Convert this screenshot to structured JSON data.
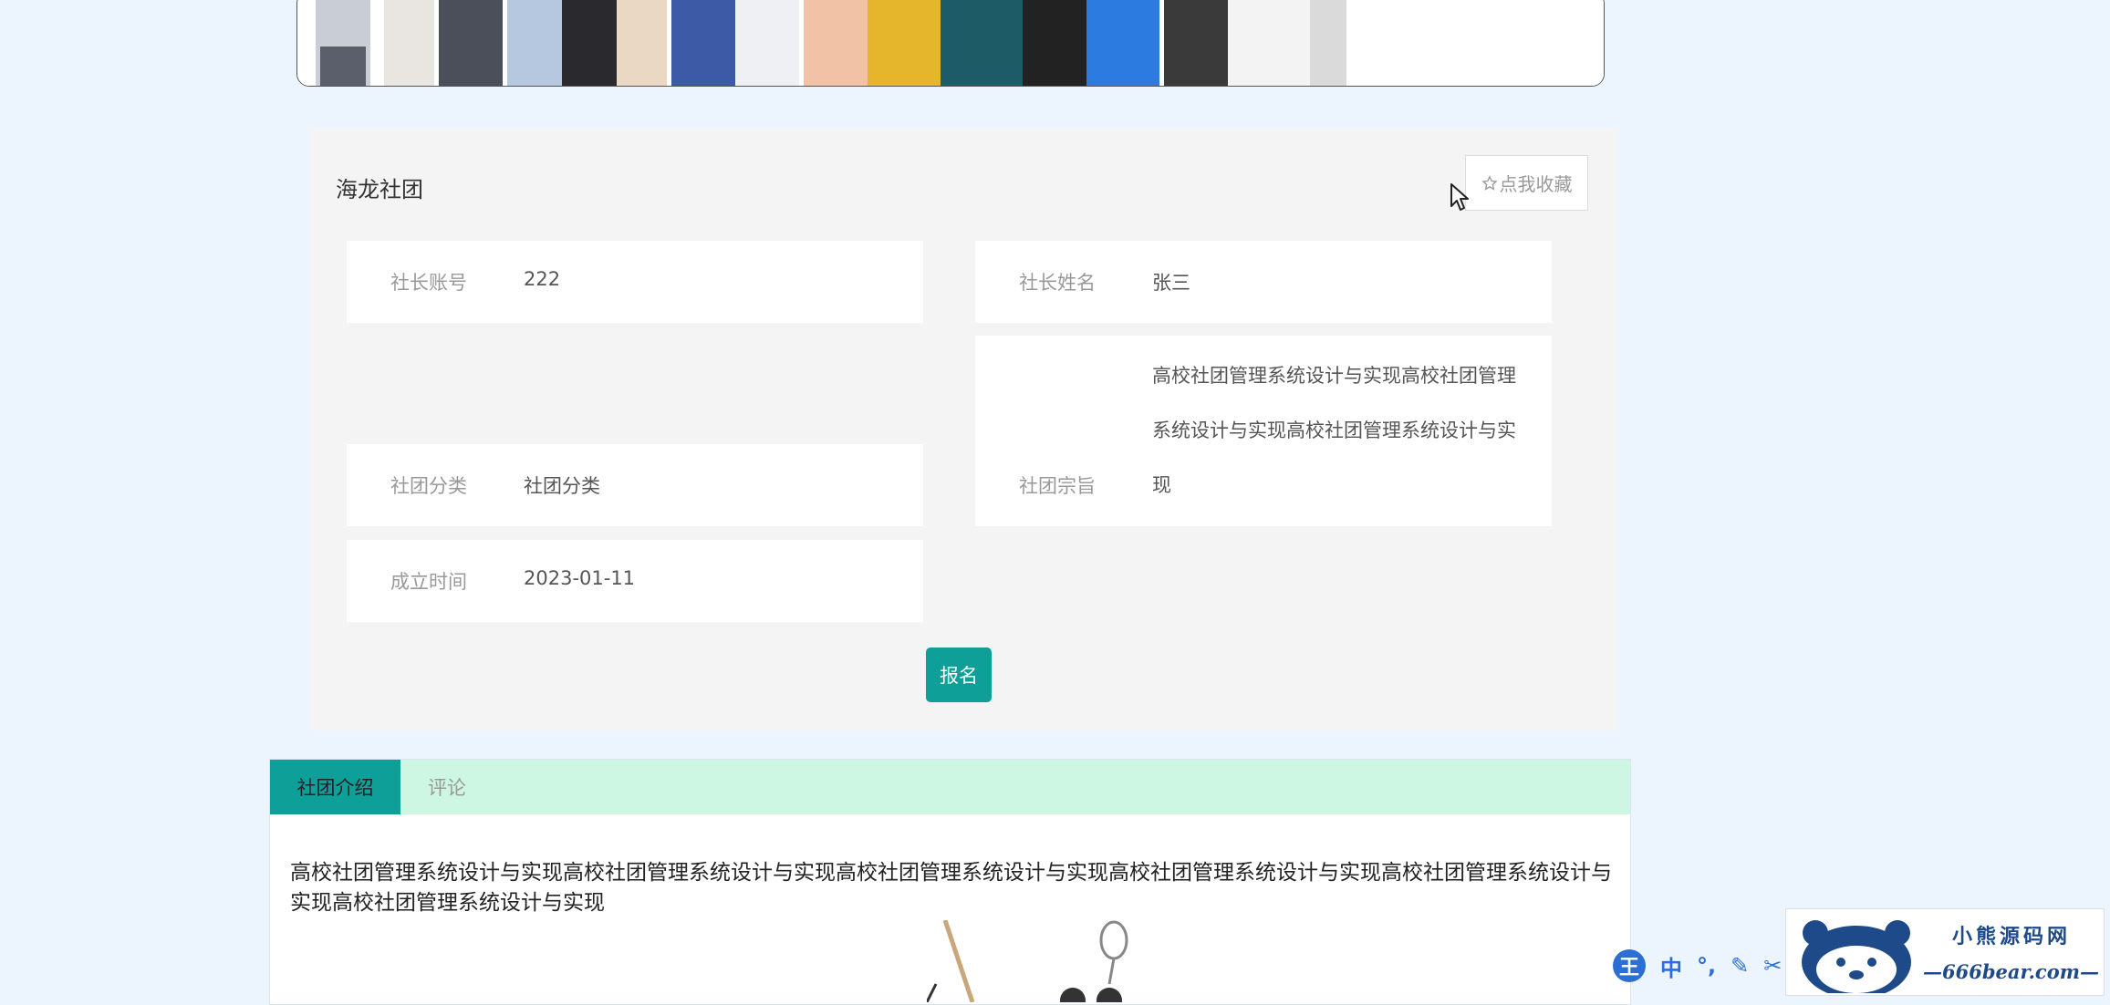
{
  "club": {
    "name": "海龙社团",
    "favorite_label": "点我收藏",
    "fields": [
      {
        "label": "社长账号",
        "value": "222"
      },
      {
        "label": "社长姓名",
        "value": "张三"
      },
      {
        "label": "社团分类",
        "value": "社团分类"
      },
      {
        "label": "社团宗旨",
        "value": "高校社团管理系统设计与实现高校社团管理系统设计与实现高校社团管理系统设计与实现"
      },
      {
        "label": "成立时间",
        "value": "2023-01-11"
      }
    ],
    "signup_label": "报名"
  },
  "tabs": [
    {
      "label": "社团介绍",
      "active": true
    },
    {
      "label": "评论",
      "active": false
    }
  ],
  "intro": {
    "text": "高校社团管理系统设计与实现高校社团管理系统设计与实现高校社团管理系统设计与实现高校社团管理系统设计与实现高校社团管理系统设计与实现高校社团管理系统设计与实现"
  },
  "ime": {
    "logo": "王",
    "items": [
      "中",
      "°,",
      "✎",
      "✂"
    ]
  },
  "watermark": {
    "title": "小熊源码网",
    "url": "—666bear.com—"
  },
  "colors": {
    "accent": "#0d9f98",
    "tab_bar": "#cdf7e2",
    "page_bg": "#ecf4fd",
    "card_bg": "#f4f4f4"
  }
}
